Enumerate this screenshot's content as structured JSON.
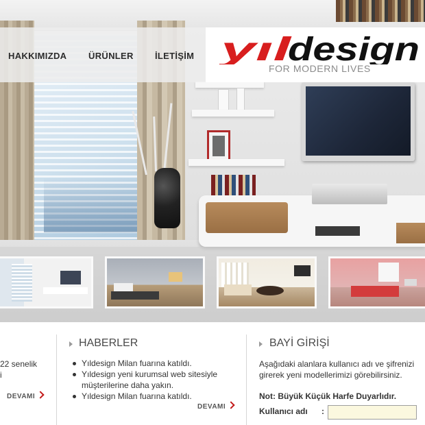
{
  "nav": {
    "items": [
      {
        "label": "HAKKIMIZDA"
      },
      {
        "label": "ÜRÜNLER"
      },
      {
        "label": "İLETİŞİM"
      }
    ]
  },
  "logo": {
    "brand": "yıldesign",
    "tagline": "FOR MODERN LIVES",
    "brand_color": "#d81e1e"
  },
  "content": {
    "about_partial": {
      "line1": "22 senelik",
      "line2": "i",
      "more_label": "DEVAMI"
    },
    "news": {
      "heading": "HABERLER",
      "items": [
        "Yıldesign Milan fuarına katıldı.",
        "Yıldesign yeni kurumsal web sitesiyle müşterilerine daha yakın.",
        "Yıldesign Milan fuarına katıldı."
      ],
      "more_label": "DEVAMI"
    },
    "dealer": {
      "heading": "BAYİ GİRİŞİ",
      "description": "Aşağıdaki alanlara kullanıcı adı ve şifrenizi girerek yeni modellerimizi görebilirsiniz.",
      "note": "Not: Büyük Küçük Harfe Duyarlıdır.",
      "username_label": "Kullanıcı adı",
      "colon": ":",
      "username_value": ""
    }
  },
  "colors": {
    "accent_red": "#c21a1a",
    "input_bg": "#fbf8df"
  }
}
